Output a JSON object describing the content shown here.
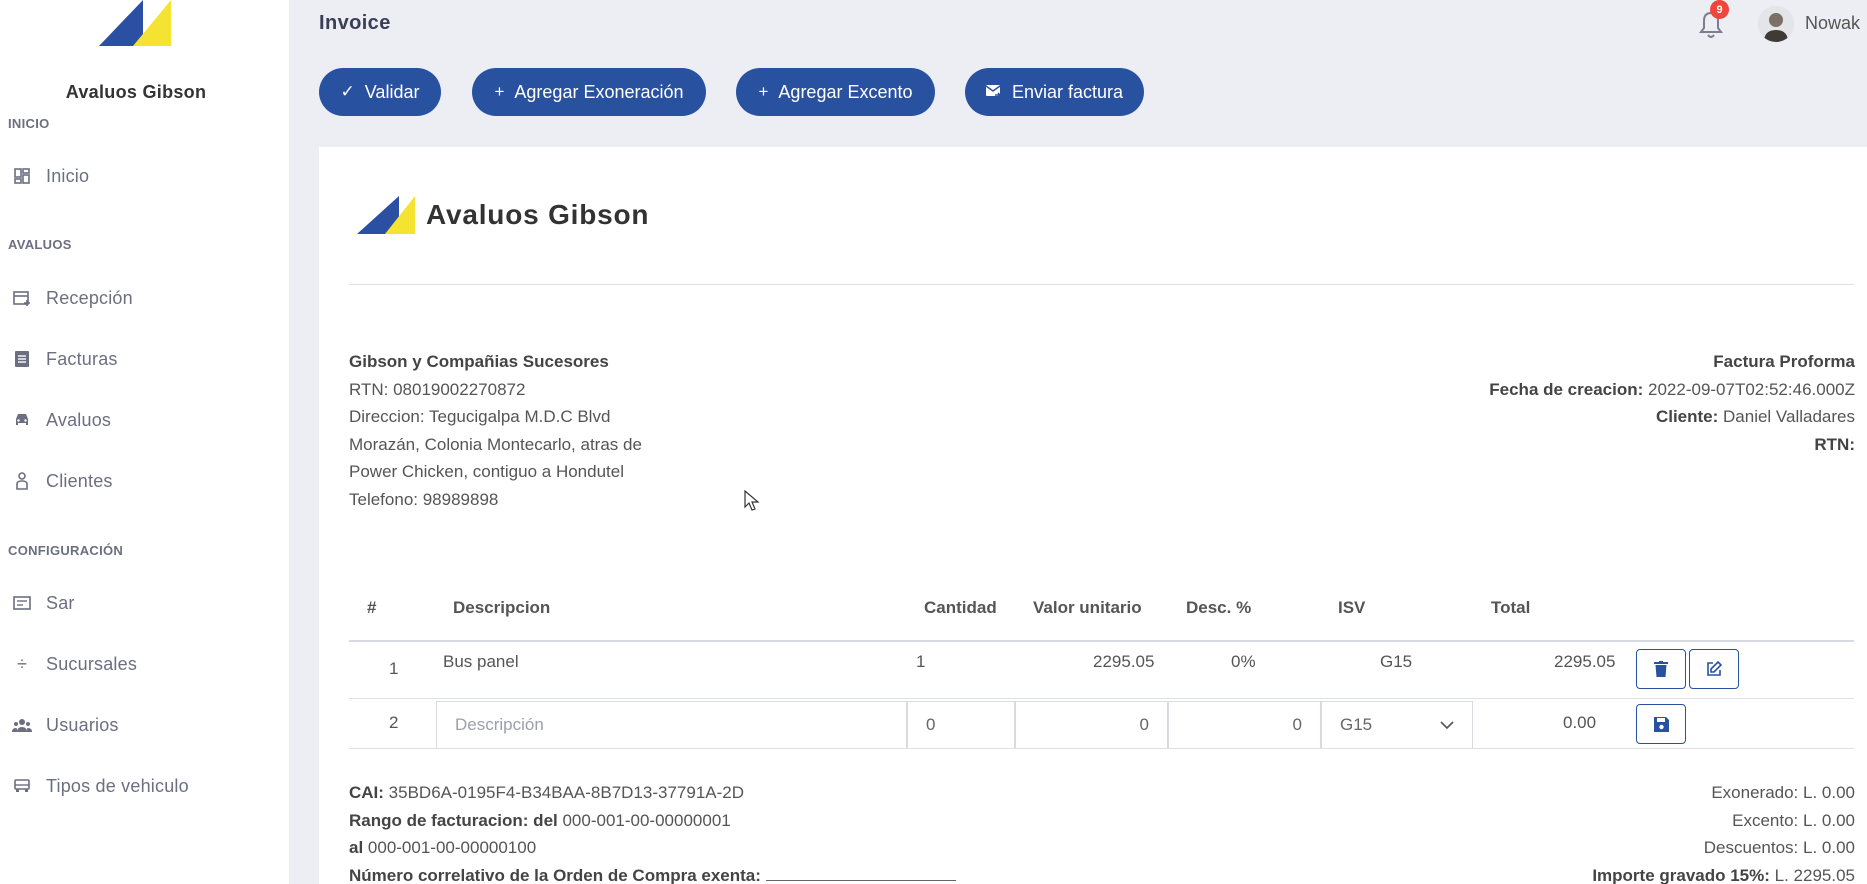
{
  "brand": {
    "name": "Avaluos Gibson"
  },
  "header": {
    "title": "Invoice",
    "notifications_count": "9",
    "user_name": "Nowak"
  },
  "sidebar": {
    "sections": [
      {
        "label": "INICIO"
      },
      {
        "label": "AVALUOS"
      },
      {
        "label": "CONFIGURACIÓN"
      }
    ],
    "items": [
      {
        "label": "Inicio",
        "icon": "dashboard-icon"
      },
      {
        "label": "Recepción",
        "icon": "calendar-plus-icon"
      },
      {
        "label": "Facturas",
        "icon": "list-icon"
      },
      {
        "label": "Avaluos",
        "icon": "car-icon"
      },
      {
        "label": "Clientes",
        "icon": "person-icon"
      },
      {
        "label": "Sar",
        "icon": "register-icon"
      },
      {
        "label": "Sucursales",
        "icon": "divide-icon"
      },
      {
        "label": "Usuarios",
        "icon": "users-icon"
      },
      {
        "label": "Tipos de vehiculo",
        "icon": "vehicle-icon"
      }
    ]
  },
  "toolbar": {
    "validar": "Validar",
    "agregar_exoneracion": "Agregar Exoneración",
    "agregar_excento": "Agregar Excento",
    "enviar_factura": "Enviar factura"
  },
  "company": {
    "name": "Gibson y Compañias Sucesores",
    "rtn": "RTN: 08019002270872",
    "address_1": "Direccion: Tegucigalpa M.D.C Blvd",
    "address_2": "Morazán, Colonia Montecarlo, atras de",
    "address_3": "Power Chicken, contiguo a Hondutel",
    "phone": "Telefono: 98989898"
  },
  "invoice_meta": {
    "type": "Factura Proforma",
    "fecha_label": "Fecha de creacion:",
    "fecha_value": " 2022-09-07T02:52:46.000Z",
    "cliente_label": "Cliente:",
    "cliente_value": " Daniel Valladares",
    "rtn_label": "RTN:"
  },
  "table": {
    "headers": [
      "#",
      "Descripcion",
      "Cantidad",
      "Valor unitario",
      "Desc. %",
      "ISV",
      "Total"
    ],
    "rows": [
      {
        "num": "1",
        "descripcion": "Bus panel",
        "cantidad": "1",
        "valor": "2295.05",
        "desc": "0%",
        "isv": "G15",
        "total": "2295.05"
      }
    ],
    "new_row": {
      "num": "2",
      "descripcion_placeholder": "Descripción",
      "cantidad": "0",
      "valor": "0",
      "desc": "0",
      "isv": "G15",
      "total": "0.00"
    }
  },
  "footer": {
    "cai_label": "CAI:",
    "cai_value": " 35BD6A-0195F4-B34BAA-8B7D13-37791A-2D",
    "rango_label": "Rango de facturacion: del",
    "rango_del": " 000-001-00-00000001",
    "al_label": "al",
    "rango_al": " 000-001-00-00000100",
    "orden_label": "Número correlativo de la Orden de Compra exenta:",
    "exonerado": "Exonerado: L. 0.00",
    "excento": "Excento: L. 0.00",
    "descuentos": "Descuentos: L. 0.00",
    "importe_label": "Importe gravado 15%:",
    "importe_value": " L. 2295.05"
  },
  "colors": {
    "primary": "#2851a0",
    "badge": "#f0453a",
    "logo_blue": "#2b4fa2",
    "logo_yellow": "#f4e431"
  }
}
